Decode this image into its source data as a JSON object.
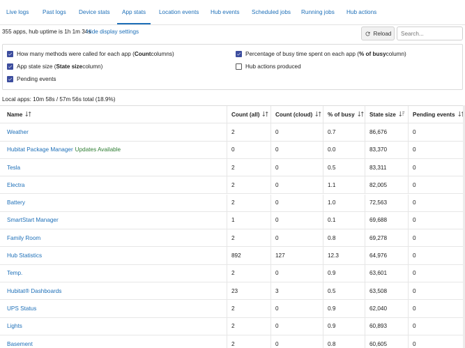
{
  "tabs": [
    {
      "label": "Live logs",
      "active": false
    },
    {
      "label": "Past logs",
      "active": false
    },
    {
      "label": "Device stats",
      "active": false
    },
    {
      "label": "App stats",
      "active": true
    },
    {
      "label": "Location events",
      "active": false
    },
    {
      "label": "Hub events",
      "active": false
    },
    {
      "label": "Scheduled jobs",
      "active": false
    },
    {
      "label": "Running jobs",
      "active": false
    },
    {
      "label": "Hub actions",
      "active": false
    }
  ],
  "summary": "355 apps, hub uptime is 1h 1m 34s",
  "toggle_settings_label": "Hide display settings",
  "reload_label": "Reload",
  "search": {
    "placeholder": "Search...",
    "value": ""
  },
  "settings": {
    "opt_count": {
      "text_before": "How many methods were called for each app (",
      "bold": "Count",
      "text_after": " columns)",
      "checked": true
    },
    "opt_busy": {
      "text_before": "Percentage of busy time spent on each app (",
      "bold": "% of busy",
      "text_after": " column)",
      "checked": true
    },
    "opt_state": {
      "text_before": "App state size (",
      "bold": "State size",
      "text_after": " column)",
      "checked": true
    },
    "opt_hub_actions": {
      "text_before": "Hub actions produced",
      "bold": "",
      "text_after": "",
      "checked": false
    },
    "opt_pending": {
      "text_before": "Pending events",
      "bold": "",
      "text_after": "",
      "checked": true
    }
  },
  "local_apps_summary": "Local apps: 10m 58s / 57m 56s total (18.9%)",
  "table": {
    "columns": [
      {
        "label": "Name",
        "sort": "none"
      },
      {
        "label": "Count (all)",
        "sort": "none"
      },
      {
        "label": "Count (cloud)",
        "sort": "none"
      },
      {
        "label": "% of busy",
        "sort": "none"
      },
      {
        "label": "State size",
        "sort": "desc"
      },
      {
        "label": "Pending events",
        "sort": "none"
      }
    ],
    "rows": [
      {
        "name": "Weather",
        "note": "",
        "count_all": "2",
        "count_cloud": "0",
        "busy": "0.7",
        "state_size": "86,676",
        "pending": "0"
      },
      {
        "name": "Hubitat Package Manager",
        "note": "Updates Available",
        "count_all": "0",
        "count_cloud": "0",
        "busy": "0.0",
        "state_size": "83,370",
        "pending": "0"
      },
      {
        "name": "Tesla",
        "note": "",
        "count_all": "2",
        "count_cloud": "0",
        "busy": "0.5",
        "state_size": "83,311",
        "pending": "0"
      },
      {
        "name": "Electra",
        "note": "",
        "count_all": "2",
        "count_cloud": "0",
        "busy": "1.1",
        "state_size": "82,005",
        "pending": "0"
      },
      {
        "name": "Battery",
        "note": "",
        "count_all": "2",
        "count_cloud": "0",
        "busy": "1.0",
        "state_size": "72,563",
        "pending": "0"
      },
      {
        "name": "SmartStart Manager",
        "note": "",
        "count_all": "1",
        "count_cloud": "0",
        "busy": "0.1",
        "state_size": "69,688",
        "pending": "0"
      },
      {
        "name": "Family Room",
        "note": "",
        "count_all": "2",
        "count_cloud": "0",
        "busy": "0.8",
        "state_size": "69,278",
        "pending": "0"
      },
      {
        "name": "Hub Statistics",
        "note": "",
        "count_all": "892",
        "count_cloud": "127",
        "busy": "12.3",
        "state_size": "64,976",
        "pending": "0"
      },
      {
        "name": "Temp.",
        "note": "",
        "count_all": "2",
        "count_cloud": "0",
        "busy": "0.9",
        "state_size": "63,601",
        "pending": "0"
      },
      {
        "name": "Hubitat® Dashboards",
        "note": "",
        "count_all": "23",
        "count_cloud": "3",
        "busy": "0.5",
        "state_size": "63,508",
        "pending": "0"
      },
      {
        "name": "UPS Status",
        "note": "",
        "count_all": "2",
        "count_cloud": "0",
        "busy": "0.9",
        "state_size": "62,040",
        "pending": "0"
      },
      {
        "name": "Lights",
        "note": "",
        "count_all": "2",
        "count_cloud": "0",
        "busy": "0.9",
        "state_size": "60,893",
        "pending": "0"
      },
      {
        "name": "Basement",
        "note": "",
        "count_all": "2",
        "count_cloud": "0",
        "busy": "0.8",
        "state_size": "60,605",
        "pending": "0"
      }
    ]
  },
  "colors": {
    "accent": "#1d6fb8",
    "checkbox": "#3c4d9e",
    "update_note": "#2e7d32"
  }
}
